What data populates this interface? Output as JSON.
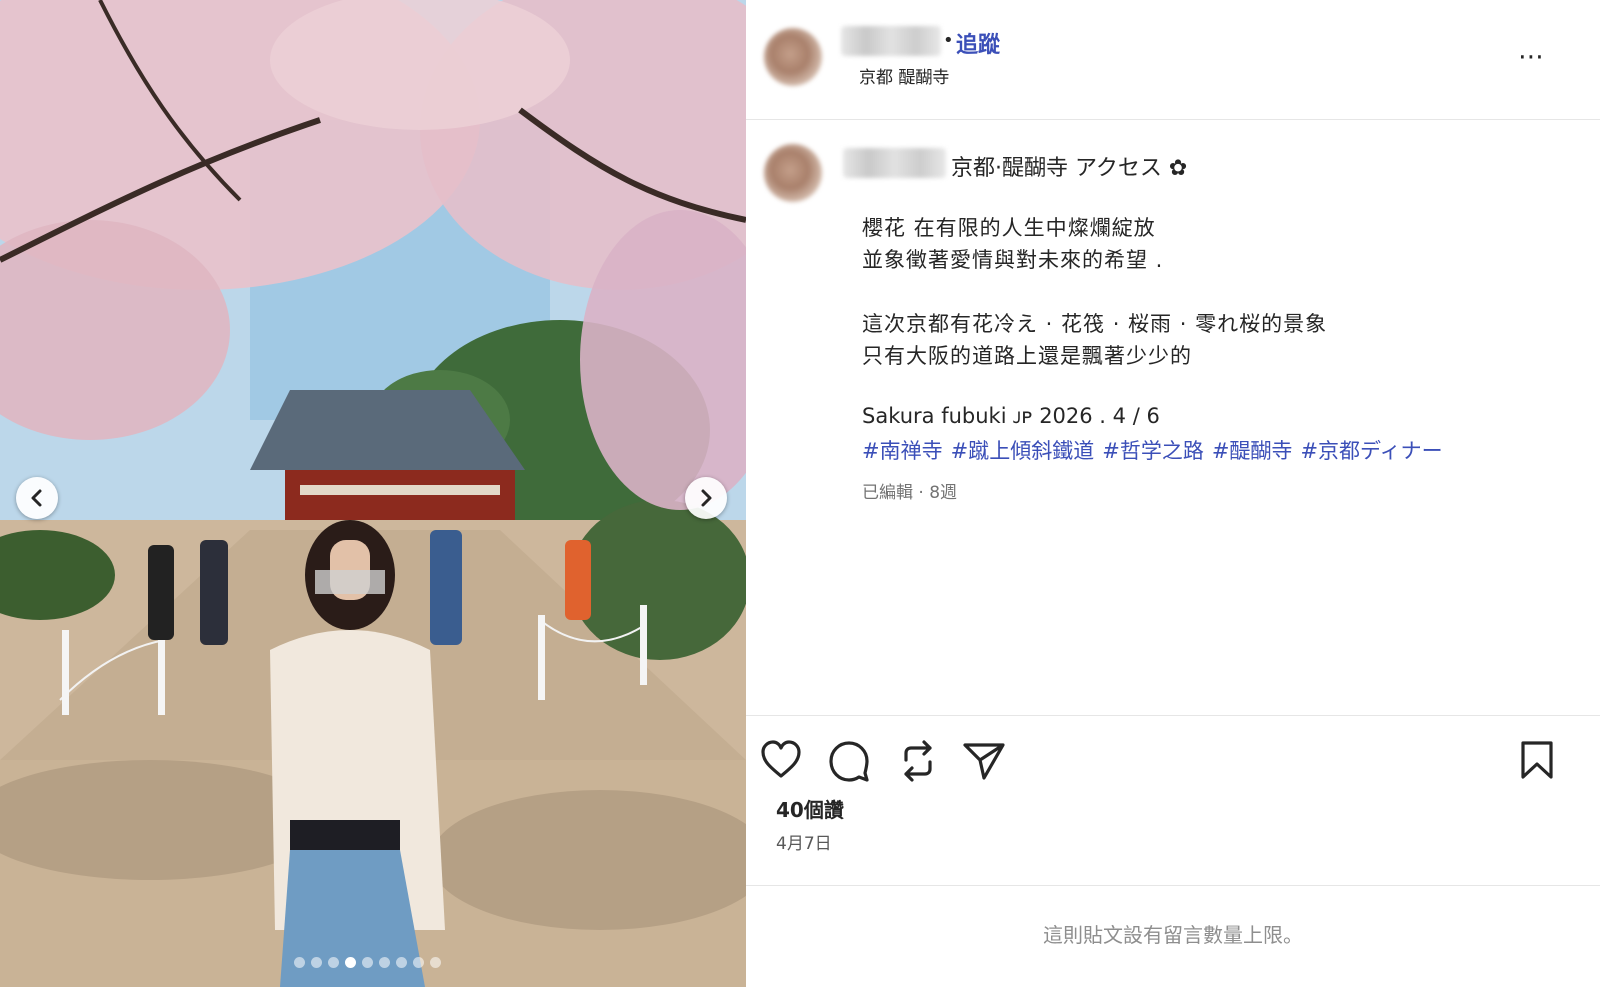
{
  "post": {
    "follow_dot": "•",
    "follow_label": "追蹤",
    "location": "京都 醍醐寺",
    "more_icon": "⋯",
    "caption_head": "京都·醍醐寺 アクセス ✿",
    "caption_lines": [
      "櫻花 在有限的人生中燦爛綻放",
      "並象徵著愛情與對未來的希望 .",
      "這次京都有花冷え · 花筏 · 桜雨 · 零れ桜的景象",
      "只有大阪的道路上還是飄著少少的",
      "Sakura fubuki ᴊᴘ 2026 . 4 / 6"
    ],
    "hashtags": [
      "#南禅寺",
      "#蹴上傾斜鐵道",
      "#哲学之路",
      "#醍醐寺",
      "#京都ディナー"
    ],
    "meta": "已編輯 · 8週",
    "likes": "40個讚",
    "date": "4月7日",
    "footer_note": "這則貼文設有留言數量上限。"
  },
  "carousel": {
    "dot_count": 9,
    "active_index": 3
  },
  "icons": [
    "chevron-left-icon",
    "chevron-right-icon",
    "heart-icon",
    "comment-icon",
    "repost-icon",
    "share-icon",
    "bookmark-icon",
    "more-icon"
  ]
}
